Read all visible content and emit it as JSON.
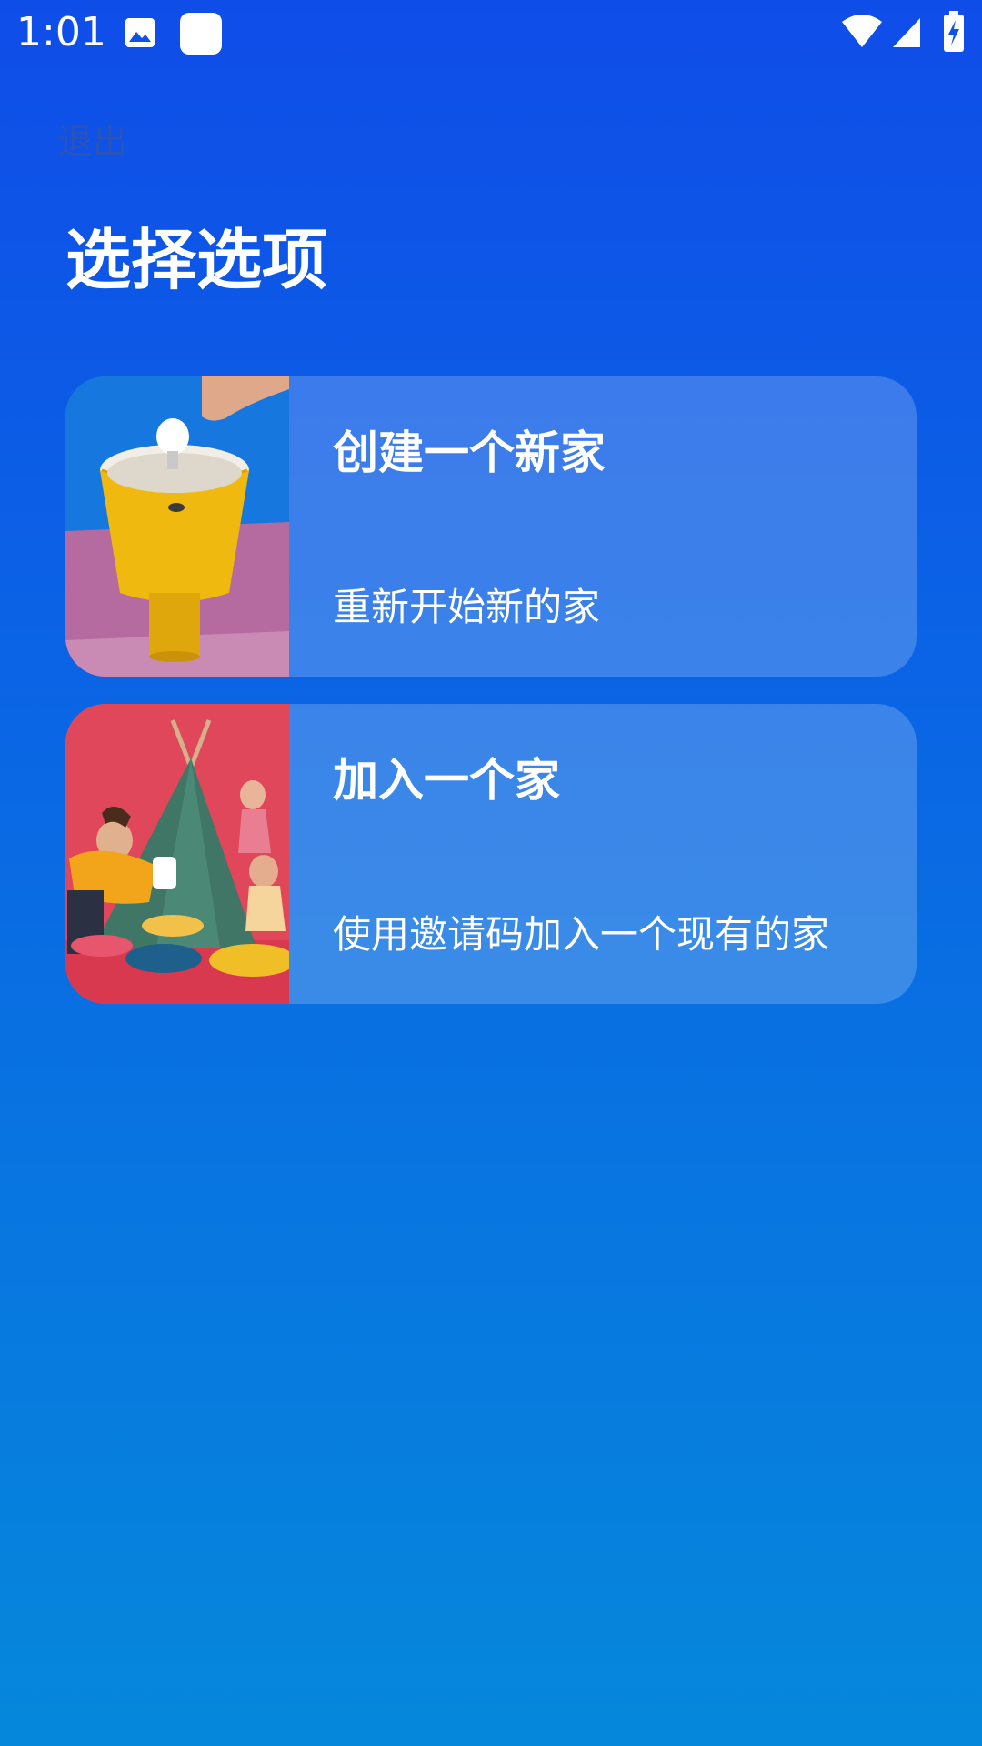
{
  "status_bar": {
    "time": "1:01",
    "icons": [
      "gallery-icon",
      "app-notification-icon",
      "wifi-icon",
      "signal-icon",
      "battery-charging-icon"
    ]
  },
  "header": {
    "exit_label": "退出",
    "title": "选择选项"
  },
  "options": [
    {
      "title": "创建一个新家",
      "subtitle": "重新开始新的家",
      "image": "lamp-photo"
    },
    {
      "title": "加入一个家",
      "subtitle": "使用邀请码加入一个现有的家",
      "image": "family-tent-photo"
    }
  ],
  "colors": {
    "background_top": "#0f4de8",
    "background_bottom": "#0588db",
    "card_fill": "rgba(255,255,255,0.20)",
    "exit_text": "#2b54b8"
  }
}
